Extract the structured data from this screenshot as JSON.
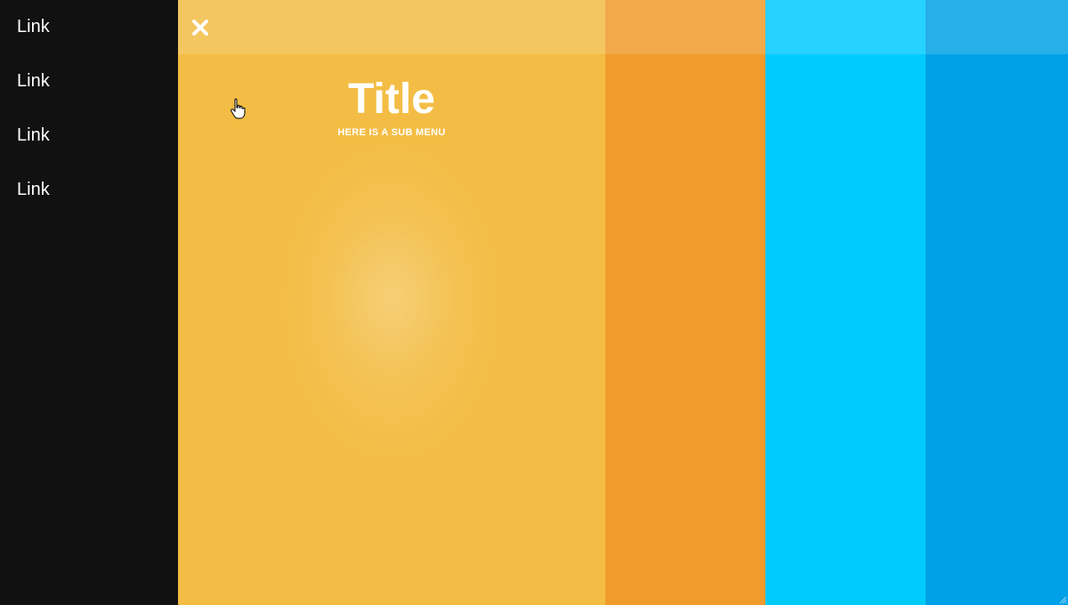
{
  "side_menu": {
    "items": [
      {
        "label": "Link"
      },
      {
        "label": "Link"
      },
      {
        "label": "Link"
      },
      {
        "label": "Link"
      }
    ]
  },
  "header": {
    "close_icon": "close-icon"
  },
  "hero": {
    "title": "Title",
    "subtitle": "HERE IS A SUB MENU"
  },
  "colors": {
    "menu_bg": "#111111",
    "yellow": "#f3bd45",
    "orange": "#f09b2b",
    "cyan": "#00cbff",
    "blue": "#00a1e6"
  }
}
